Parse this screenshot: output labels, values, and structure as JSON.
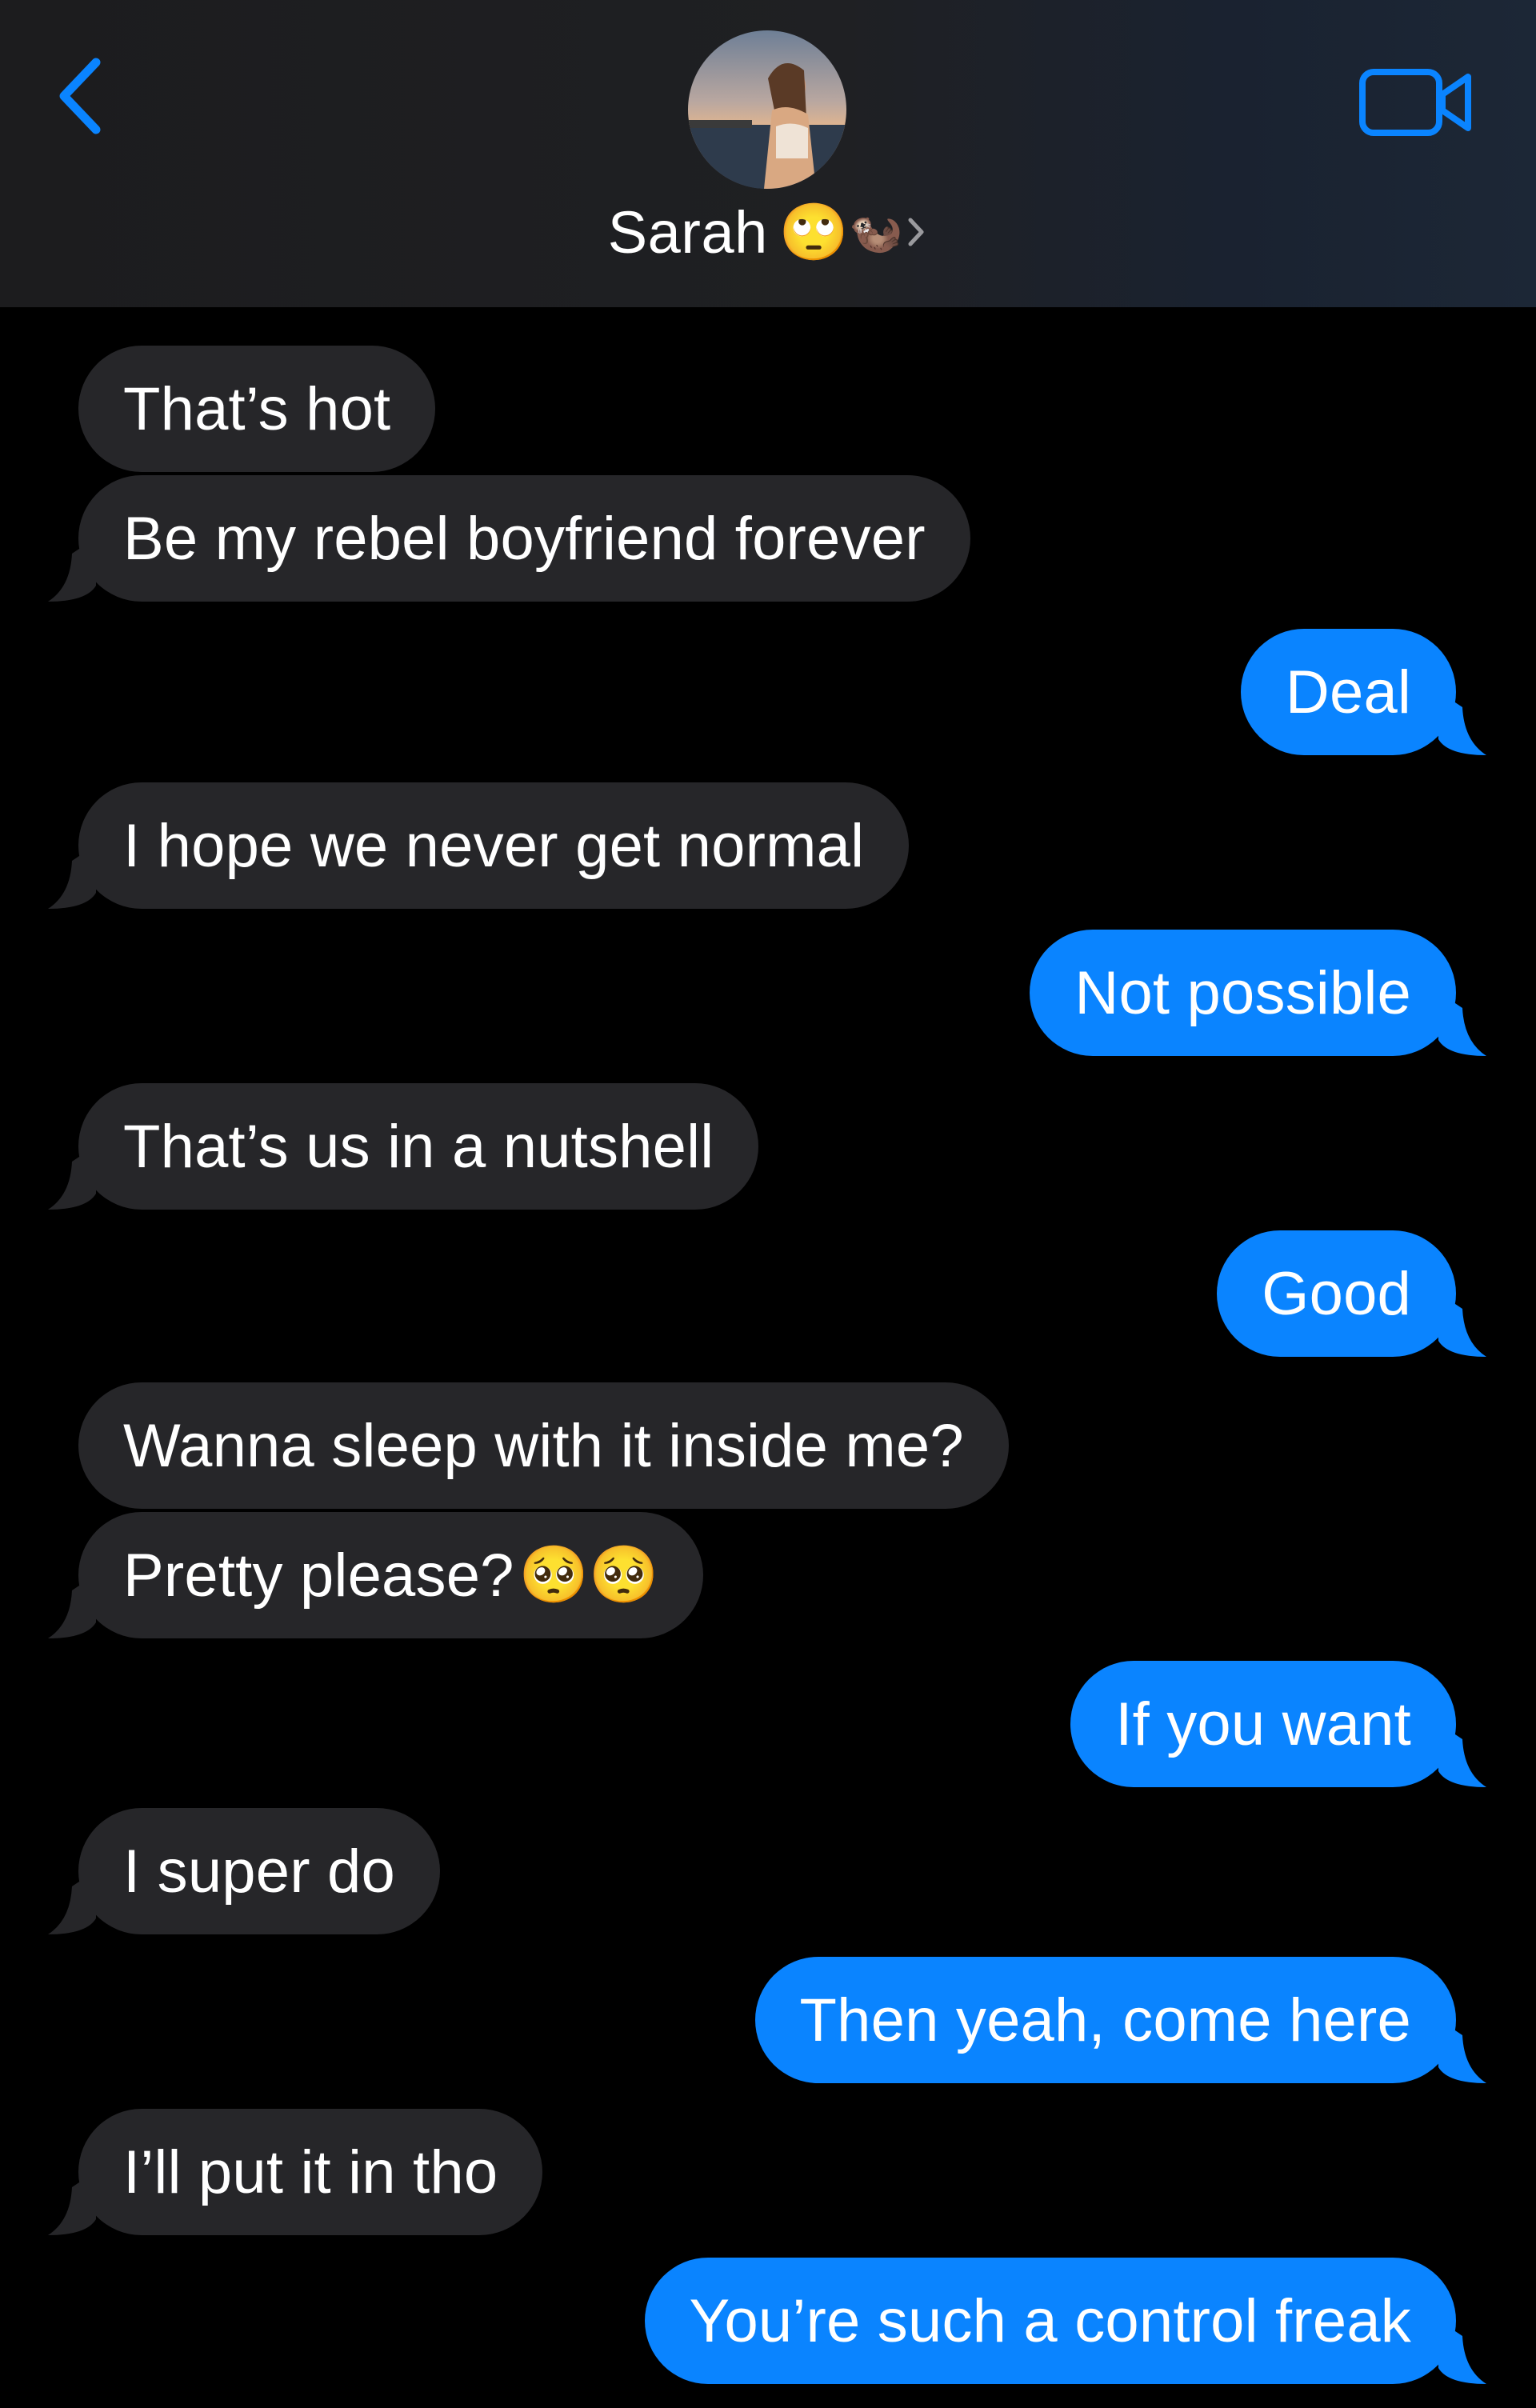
{
  "header": {
    "contact_name": "Sarah",
    "contact_emoji_1": "🙄",
    "contact_emoji_2": "🦦",
    "back_icon": "chevron-left-icon",
    "video_icon": "video-camera-icon",
    "accent_color": "#0a84ff"
  },
  "messages": [
    {
      "dir": "in",
      "text": "That’s hot"
    },
    {
      "dir": "in",
      "text": "Be my rebel boyfriend forever"
    },
    {
      "dir": "out",
      "text": "Deal"
    },
    {
      "dir": "in",
      "text": "I hope we never get normal"
    },
    {
      "dir": "out",
      "text": "Not possible"
    },
    {
      "dir": "in",
      "text": "That’s us in a nutshell"
    },
    {
      "dir": "out",
      "text": "Good"
    },
    {
      "dir": "in",
      "text": "Wanna sleep with it inside me?"
    },
    {
      "dir": "in",
      "text": "Pretty please?",
      "emoji": "🥺🥺"
    },
    {
      "dir": "out",
      "text": "If you want"
    },
    {
      "dir": "in",
      "text": "I super do"
    },
    {
      "dir": "out",
      "text": "Then yeah, come here"
    },
    {
      "dir": "in",
      "text": "I’ll put it in tho"
    },
    {
      "dir": "out",
      "text": "You’re such a control freak"
    }
  ],
  "colors": {
    "incoming_bubble": "#262629",
    "outgoing_bubble": "#0a84ff",
    "background": "#000000"
  }
}
